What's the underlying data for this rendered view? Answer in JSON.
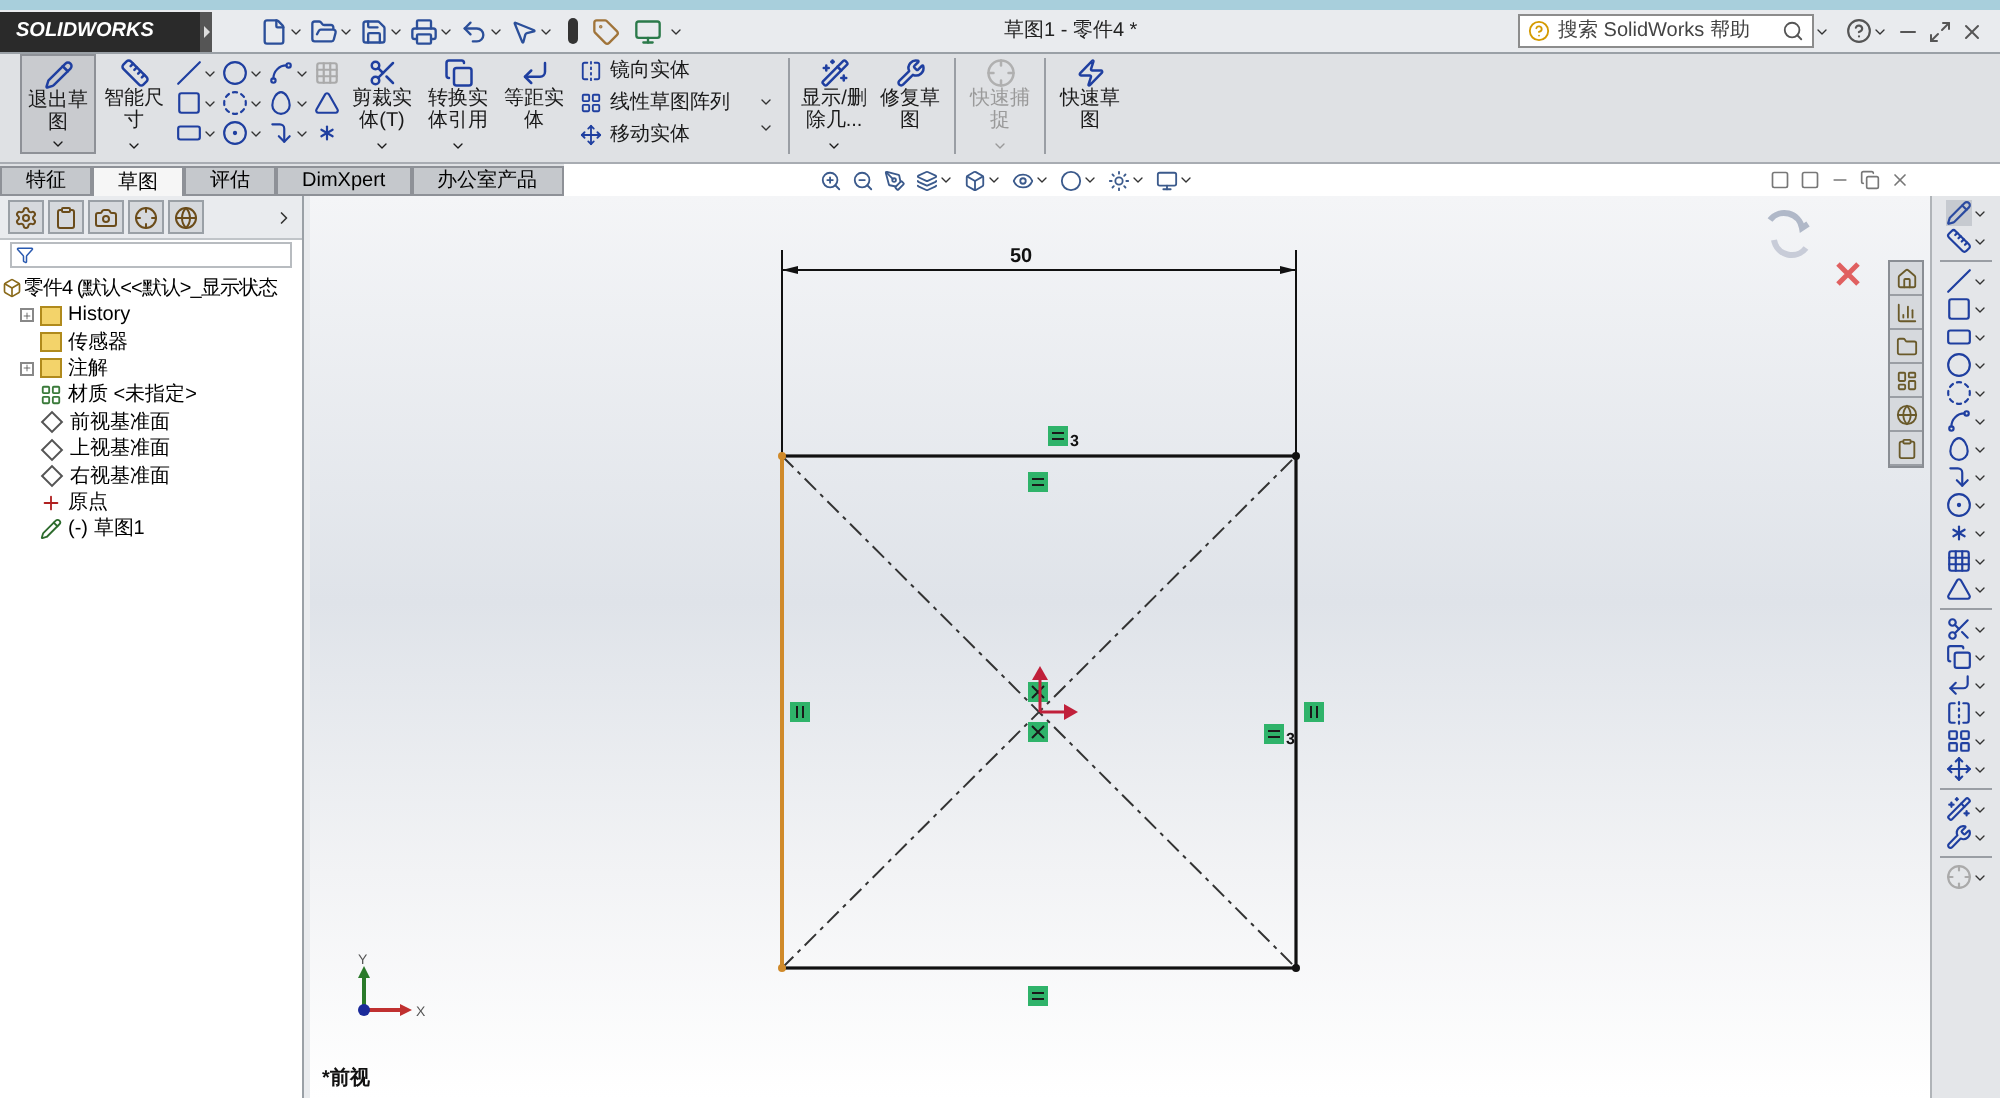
{
  "app": {
    "logo": "SOLIDWORKS",
    "title": "草图1 - 零件4 *"
  },
  "search": {
    "placeholder": "搜索 SolidWorks 帮助"
  },
  "ribbon": [
    {
      "kind": "large",
      "label": "退出草图",
      "selected": true,
      "disabled": false,
      "has_menu": true
    },
    {
      "kind": "large",
      "label": "智能尺寸",
      "selected": false,
      "disabled": false,
      "has_menu": true
    },
    {
      "kind": "grid"
    },
    {
      "kind": "large",
      "label": "剪裁实体(T)",
      "selected": false,
      "disabled": false,
      "has_menu": true
    },
    {
      "kind": "large",
      "label": "转换实体引用",
      "selected": false,
      "disabled": false,
      "has_menu": true
    },
    {
      "kind": "large",
      "label": "等距实体",
      "selected": false,
      "disabled": false,
      "has_menu": false
    },
    {
      "kind": "list",
      "items": [
        "镜向实体",
        "线性草图阵列",
        "移动实体"
      ]
    },
    {
      "kind": "separator"
    },
    {
      "kind": "large",
      "label": "显示/删除几...",
      "selected": false,
      "disabled": false,
      "has_menu": true
    },
    {
      "kind": "large",
      "label": "修复草图",
      "selected": false,
      "disabled": false,
      "has_menu": false
    },
    {
      "kind": "separator"
    },
    {
      "kind": "large",
      "label": "快速捕捉",
      "selected": false,
      "disabled": true,
      "has_menu": true
    },
    {
      "kind": "separator"
    },
    {
      "kind": "large",
      "label": "快速草图",
      "selected": false,
      "disabled": false,
      "has_menu": false
    }
  ],
  "tabs": [
    {
      "label": "特征",
      "selected": false
    },
    {
      "label": "草图",
      "selected": true
    },
    {
      "label": "评估",
      "selected": false
    },
    {
      "label": "DimXpert",
      "selected": false
    },
    {
      "label": "办公室产品",
      "selected": false
    }
  ],
  "tree": {
    "root": "零件4 (默认<<默认>_显示状态",
    "items": [
      {
        "label": "History",
        "kind": "folder",
        "expandable": true
      },
      {
        "label": "传感器",
        "kind": "folder",
        "expandable": false
      },
      {
        "label": "注解",
        "kind": "annotation",
        "expandable": true
      },
      {
        "label": "材质 <未指定>",
        "kind": "material",
        "expandable": false
      },
      {
        "label": "前视基准面",
        "kind": "plane",
        "expandable": false
      },
      {
        "label": "上视基准面",
        "kind": "plane",
        "expandable": false
      },
      {
        "label": "右视基准面",
        "kind": "plane",
        "expandable": false
      },
      {
        "label": "原点",
        "kind": "origin",
        "expandable": false
      },
      {
        "label": "(-) 草图1",
        "kind": "sketch",
        "expandable": false
      }
    ]
  },
  "sketch": {
    "dimension": "50",
    "edges": [
      {
        "kind": "top",
        "selected": false
      },
      {
        "kind": "right",
        "selected": false
      },
      {
        "kind": "bottom",
        "selected": false
      },
      {
        "kind": "left",
        "selected": true
      }
    ],
    "relations": [
      {
        "kind": "horizontal",
        "count": "3"
      },
      {
        "kind": "horizontal"
      },
      {
        "kind": "vertical"
      },
      {
        "kind": "vertical"
      },
      {
        "kind": "horizontal",
        "count": "3"
      },
      {
        "kind": "horizontal"
      },
      {
        "kind": "midpoint"
      },
      {
        "kind": "midpoint"
      }
    ]
  },
  "triad": {
    "x": "X",
    "y": "Y"
  },
  "view_label": "*前视"
}
